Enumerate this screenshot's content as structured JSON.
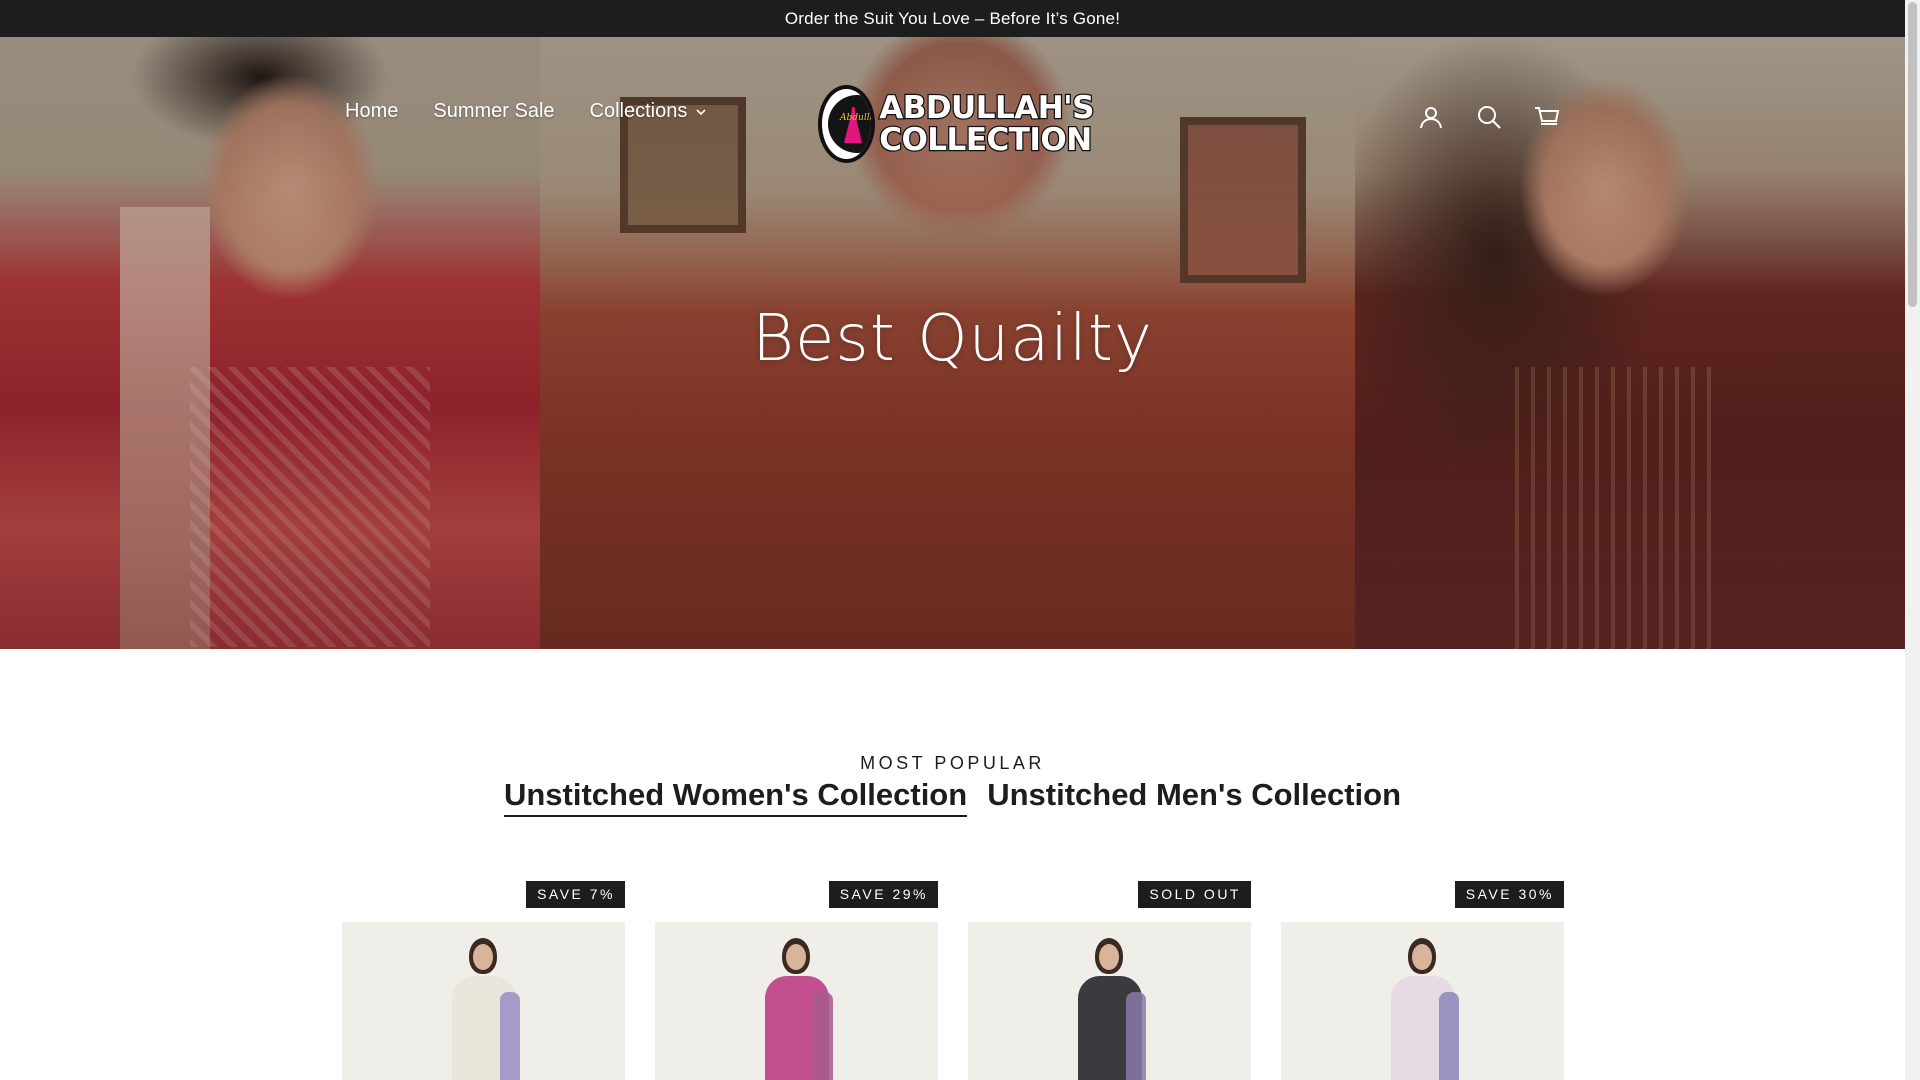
{
  "announcement": {
    "text": "Order the Suit You Love – Before It’s Gone!"
  },
  "header": {
    "nav": [
      {
        "label": "Home"
      },
      {
        "label": "Summer Sale"
      },
      {
        "label": "Collections"
      }
    ],
    "logo": {
      "line1": "ABDULLAH'S",
      "line2": "COLLECTION",
      "script": "Abdullah's"
    },
    "icons": [
      "account-icon",
      "search-icon",
      "cart-icon"
    ]
  },
  "hero": {
    "title": "Best Quailty"
  },
  "section": {
    "eyebrow": "MOST POPULAR",
    "tabs": [
      {
        "label": "Unstitched Women's Collection",
        "active": true
      },
      {
        "label": "Unstitched Men's Collection",
        "active": false
      }
    ],
    "products": [
      {
        "badge": "SAVE 7%",
        "body_color": "#e9e6dc",
        "dupatta_color": "#9b8cc4"
      },
      {
        "badge": "SAVE 29%",
        "body_color": "#c24f8f",
        "dupatta_color": "#a85b8c"
      },
      {
        "badge": "SOLD OUT",
        "body_color": "#3b3a3e",
        "dupatta_color": "#8a7aa8"
      },
      {
        "badge": "SAVE 30%",
        "body_color": "#e6dbe4",
        "dupatta_color": "#8a86b8"
      }
    ]
  },
  "colors": {
    "bar": "#1c1d1d",
    "text": "#1c1d1d",
    "white": "#ffffff"
  }
}
